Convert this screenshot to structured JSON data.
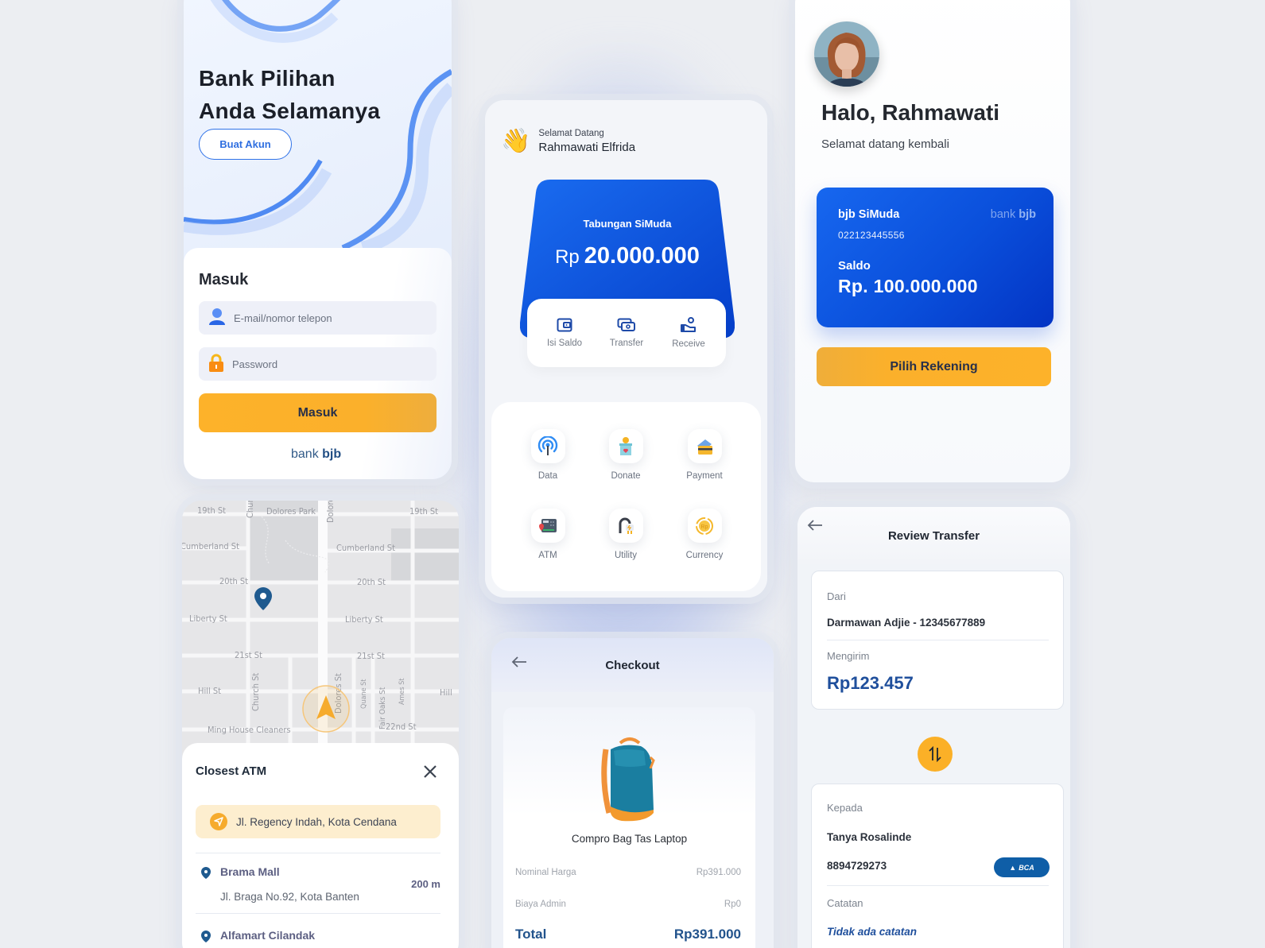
{
  "login": {
    "headline_line1": "Bank Pilihan",
    "headline_line2": "Anda Selamanya",
    "create_account_label": "Buat Akun",
    "form_title": "Masuk",
    "email_placeholder": "E-mail/nomor telepon",
    "password_placeholder": "Password",
    "submit_label": "Masuk",
    "brand_prefix": "bank",
    "brand_name": "bjb"
  },
  "map": {
    "streets": [
      "19th St",
      "Dolores Park",
      "Dolore",
      "19th St",
      "Chur",
      "Cumberland St",
      "Cumberland St",
      "20th St",
      "20th St",
      "Liberty St",
      "Liberty St",
      "21st St",
      "21st St",
      "Hill St",
      "Hill",
      "Church St",
      "Dolores St",
      "Quane St",
      "Fair Oaks St",
      "Ames St",
      "Ming House Cleaners",
      "22nd St"
    ],
    "sheet_title": "Closest ATM",
    "current_location": "Jl. Regency Indah, Kota Cendana",
    "atms": [
      {
        "name": "Brama Mall",
        "address": "Jl. Braga No.92, Kota Banten",
        "distance": "200 m"
      },
      {
        "name": "Alfamart Cilandak",
        "address": "",
        "distance": ""
      }
    ],
    "colors": {
      "pin": "#1f5a8f",
      "navigation": "#f6ab2d"
    }
  },
  "home": {
    "greeting": "Selamat Datang",
    "user_name": "Rahmawati Elfrida",
    "account_type": "Tabungan SiMuda",
    "currency": "Rp",
    "balance": "20.000.000",
    "quick_actions": [
      {
        "label": "Isi Saldo",
        "icon": "wallet-icon"
      },
      {
        "label": "Transfer",
        "icon": "money-transfer-icon"
      },
      {
        "label": "Receive",
        "icon": "receive-money-icon"
      }
    ],
    "services": [
      {
        "label": "Data",
        "icon": "signal-tower-icon"
      },
      {
        "label": "Donate",
        "icon": "donation-box-icon"
      },
      {
        "label": "Payment",
        "icon": "credit-card-icon"
      },
      {
        "label": "ATM",
        "icon": "atm-machine-icon"
      },
      {
        "label": "Utility",
        "icon": "power-plug-icon"
      },
      {
        "label": "Currency",
        "icon": "currency-coin-icon"
      }
    ]
  },
  "checkout": {
    "title": "Checkout",
    "product_name": "Compro Bag Tas Laptop",
    "rows": [
      {
        "label": "Nominal Harga",
        "value": "Rp391.000"
      },
      {
        "label": "Biaya Admin",
        "value": "Rp0"
      }
    ],
    "total_label": "Total",
    "total_value": "Rp391.000"
  },
  "profile": {
    "greeting": "Halo, Rahmawati",
    "subtitle": "Selamat datang kembali",
    "card": {
      "product": "bjb SiMuda",
      "account_number": "022123445556",
      "brand_prefix": "bank",
      "brand_name": "bjb",
      "balance_label": "Saldo",
      "balance": "Rp. 100.000.000"
    },
    "choose_account_label": "Pilih Rekening"
  },
  "review": {
    "title": "Review Transfer",
    "from_label": "Dari",
    "from_value": "Darmawan Adjie - 12345677889",
    "amount_label": "Mengirim",
    "amount_value": "Rp123.457",
    "to_label": "Kepada",
    "to_name": "Tanya Rosalinde",
    "to_account": "8894729273",
    "bank_badge": "BCA",
    "note_label": "Catatan",
    "note_value": "Tidak ada catatan"
  },
  "colors": {
    "primary_blue": "#0a4fdb",
    "accent_yellow": "#fbb02b",
    "navy_text": "#22538c",
    "background": "#eceef2"
  }
}
